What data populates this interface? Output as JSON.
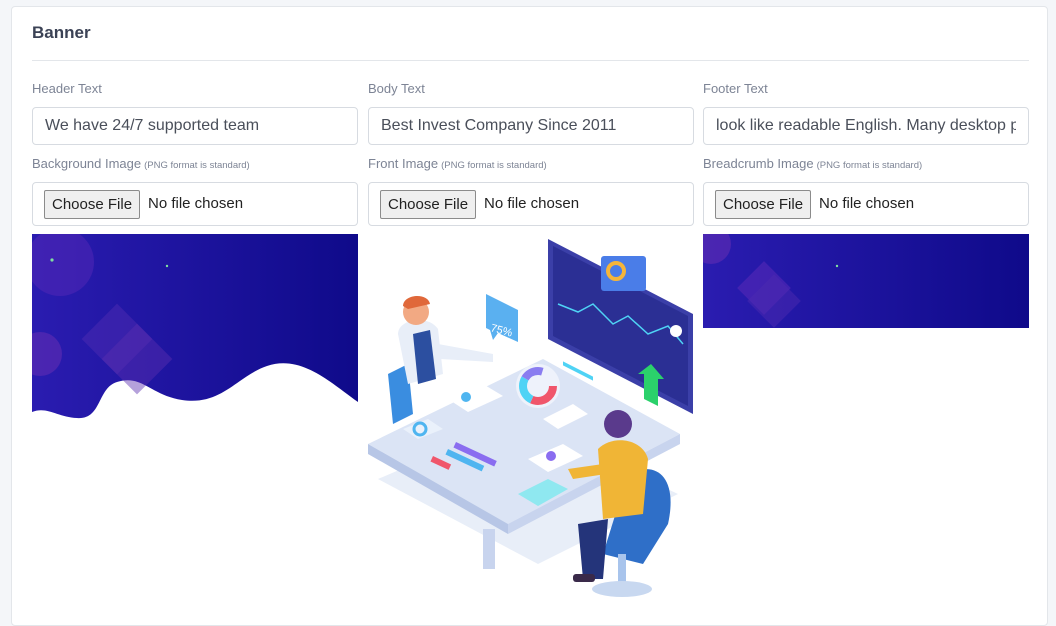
{
  "card": {
    "title": "Banner"
  },
  "fields": {
    "header": {
      "label": "Header Text",
      "value": "We have 24/7 supported team"
    },
    "body": {
      "label": "Body Text",
      "value": "Best Invest Company Since 2011"
    },
    "footer": {
      "label": "Footer Text",
      "value": "look like readable English. Many desktop p"
    }
  },
  "uploads": {
    "background": {
      "label": "Background Image",
      "hint": "(PNG format is standard)",
      "button": "Choose File",
      "status": "No file chosen"
    },
    "front": {
      "label": "Front Image",
      "hint": "(PNG format is standard)",
      "button": "Choose File",
      "status": "No file chosen"
    },
    "breadcrumb": {
      "label": "Breadcrumb Image",
      "hint": "(PNG format is standard)",
      "button": "Choose File",
      "status": "No file chosen"
    }
  },
  "illustration": {
    "badge": "75%"
  },
  "colors": {
    "banner_dark": "#1a0a8c",
    "banner_light": "#2f1fb5",
    "accent": "#4a6cf7"
  }
}
